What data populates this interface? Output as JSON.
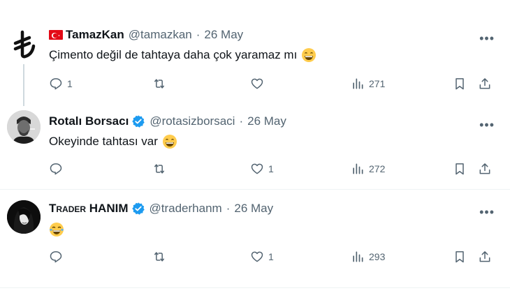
{
  "tweets": [
    {
      "name": "TamazKan",
      "handle": "@tamazkan",
      "dot": "·",
      "date": "26 May",
      "text": "Çimento değil de tahtaya daha çok yaramaz mı",
      "emoji": "grinning-face-with-smiling-eyes",
      "replies": "1",
      "retweets": "",
      "likes": "",
      "views": "271",
      "avatar": "lira-sign-icon"
    },
    {
      "name": "Rotalı Borsacı",
      "handle": "@rotasizborsaci",
      "dot": "·",
      "date": "26 May",
      "text": "Okeyinde tahtası var",
      "emoji": "grinning-face-with-smiling-eyes",
      "replies": "",
      "retweets": "",
      "likes": "1",
      "views": "272",
      "avatar": "man-portrait"
    },
    {
      "name": "Trader HANIM",
      "handle": "@traderhanm",
      "dot": "·",
      "date": "26 May",
      "text": "",
      "emoji": "face-with-tears-of-joy",
      "replies": "",
      "retweets": "",
      "likes": "1",
      "views": "293",
      "avatar": "woman-portrait"
    }
  ],
  "colors": {
    "text": "#0f1419",
    "muted": "#536471",
    "verified": "#1d9bf0",
    "flag": "#e30a17",
    "separator": "#eff3f4"
  }
}
